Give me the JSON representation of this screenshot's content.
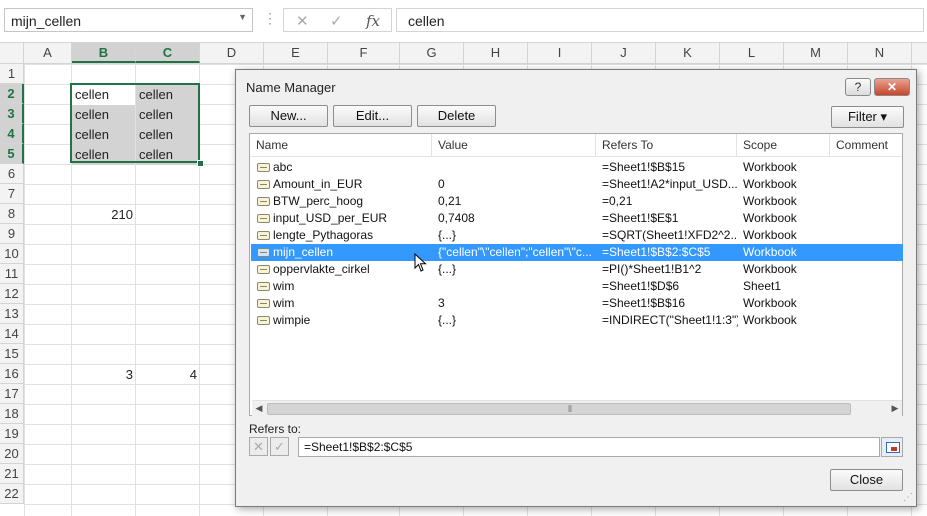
{
  "formula_bar": {
    "name_box": "mijn_cellen",
    "dots_icon": "vertical-dots-icon",
    "cancel_icon": "✕",
    "enter_icon": "✓",
    "fx_icon": "fx",
    "formula": "cellen"
  },
  "grid": {
    "columns": [
      "A",
      "B",
      "C",
      "D",
      "E",
      "F",
      "G",
      "H",
      "I",
      "J",
      "K",
      "L",
      "M",
      "N"
    ],
    "rows": [
      "1",
      "2",
      "3",
      "4",
      "5",
      "6",
      "7",
      "8",
      "9",
      "10",
      "11",
      "12",
      "13",
      "14",
      "15",
      "16",
      "17",
      "18",
      "19",
      "20",
      "21",
      "22"
    ],
    "cells": {
      "B2": "cellen",
      "C2": "cellen",
      "B3": "cellen",
      "C3": "cellen",
      "B4": "cellen",
      "C4": "cellen",
      "B5": "cellen",
      "C5": "cellen",
      "B8": "210",
      "B16": "3",
      "C16": "4"
    },
    "selection": "B2:C5",
    "selection_color": "#217346"
  },
  "dialog": {
    "title": "Name Manager",
    "help_label": "?",
    "close_x_label": "✕",
    "buttons": {
      "new": "New...",
      "edit": "Edit...",
      "delete": "Delete",
      "filter": "Filter ▾",
      "close": "Close"
    },
    "columns": [
      "Name",
      "Value",
      "Refers To",
      "Scope",
      "Comment"
    ],
    "rows": [
      {
        "name": "abc",
        "value": "",
        "refers_to": "=Sheet1!$B$15",
        "scope": "Workbook",
        "comment": ""
      },
      {
        "name": "Amount_in_EUR",
        "value": "0",
        "refers_to": "=Sheet1!A2*input_USD...",
        "scope": "Workbook",
        "comment": ""
      },
      {
        "name": "BTW_perc_hoog",
        "value": "0,21",
        "refers_to": "=0,21",
        "scope": "Workbook",
        "comment": ""
      },
      {
        "name": "input_USD_per_EUR",
        "value": "0,7408",
        "refers_to": "=Sheet1!$E$1",
        "scope": "Workbook",
        "comment": ""
      },
      {
        "name": "lengte_Pythagoras",
        "value": "{...}",
        "refers_to": "=SQRT(Sheet1!XFD2^2...",
        "scope": "Workbook",
        "comment": ""
      },
      {
        "name": "mijn_cellen",
        "value": "{\"cellen\"\\\"cellen\";\"cellen\"\\\"c...",
        "refers_to": "=Sheet1!$B$2:$C$5",
        "scope": "Workbook",
        "comment": "",
        "selected": true
      },
      {
        "name": "oppervlakte_cirkel",
        "value": "{...}",
        "refers_to": "=PI()*Sheet1!B1^2",
        "scope": "Workbook",
        "comment": ""
      },
      {
        "name": "wim",
        "value": "",
        "refers_to": "=Sheet1!$D$6",
        "scope": "Sheet1",
        "comment": ""
      },
      {
        "name": "wim",
        "value": "3",
        "refers_to": "=Sheet1!$B$16",
        "scope": "Workbook",
        "comment": ""
      },
      {
        "name": "wimpie",
        "value": "{...}",
        "refers_to": "=INDIRECT(\"Sheet1!1:3\")",
        "scope": "Workbook",
        "comment": ""
      }
    ],
    "refers_to_label": "Refers to:",
    "refers_to_value": "=Sheet1!$B$2:$C$5",
    "selected_row_color": "#3399ff"
  }
}
